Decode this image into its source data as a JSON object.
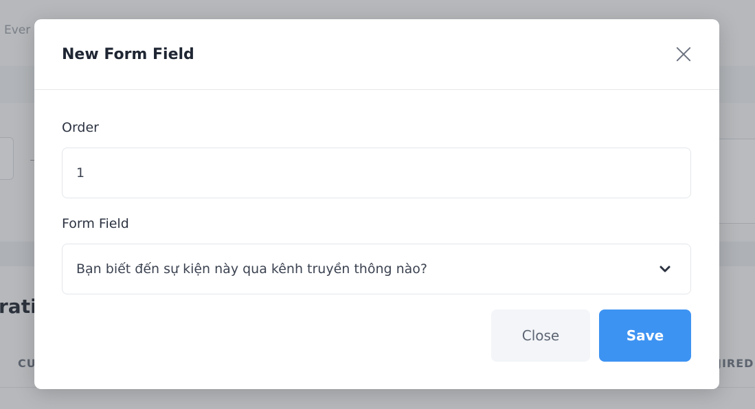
{
  "background": {
    "breadcrumb": "Ever",
    "heading": "rati",
    "column_left": "CU",
    "column_right": "JIRED"
  },
  "modal": {
    "title": "New Form Field",
    "order": {
      "label": "Order",
      "value": "1"
    },
    "form_field": {
      "label": "Form Field",
      "selected": "Bạn biết đến sự kiện này qua kênh truyền thông nào?"
    },
    "buttons": {
      "close": "Close",
      "save": "Save"
    }
  },
  "colors": {
    "primary": "#3d93f2",
    "secondary_button": "#f3f5f8"
  },
  "icons": {
    "close": "close-icon",
    "dropdown": "chevron-down-icon"
  }
}
